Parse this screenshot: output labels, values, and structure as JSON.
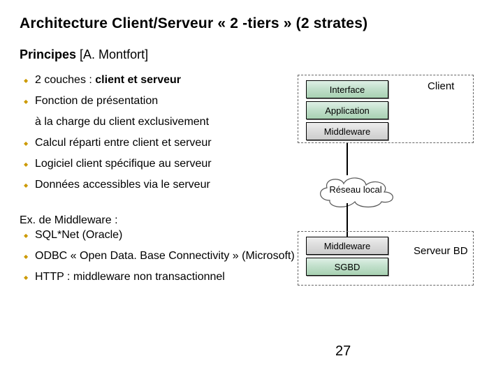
{
  "title": "Architecture Client/Serveur « 2 -tiers » (2 strates)",
  "subtitle_strong": "Principes",
  "subtitle_rest": " [A. Montfort]",
  "bullets": {
    "b1a": "2 couches : ",
    "b1b": "client et serveur",
    "b2": "Fonction de présentation",
    "b2sub": "à la charge du client exclusivement",
    "b3": "Calcul réparti entre client et serveur",
    "b4": "Logiciel client spécifique au serveur",
    "b5": "Données accessibles via le serveur"
  },
  "diagram": {
    "client_label": "Client",
    "server_label": "Serveur BD",
    "client_boxes": {
      "interface": "Interface",
      "application": "Application",
      "middleware": "Middleware"
    },
    "network": "Réseau local",
    "server_boxes": {
      "middleware": "Middleware",
      "sgbd": "SGBD"
    }
  },
  "middleware": {
    "heading": "Ex. de Middleware :",
    "m1": "SQL*Net (Oracle)",
    "m2": "ODBC « Open Data. Base Connectivity » (Microsoft)",
    "m3": "HTTP : middleware non transactionnel"
  },
  "page_number": "27"
}
